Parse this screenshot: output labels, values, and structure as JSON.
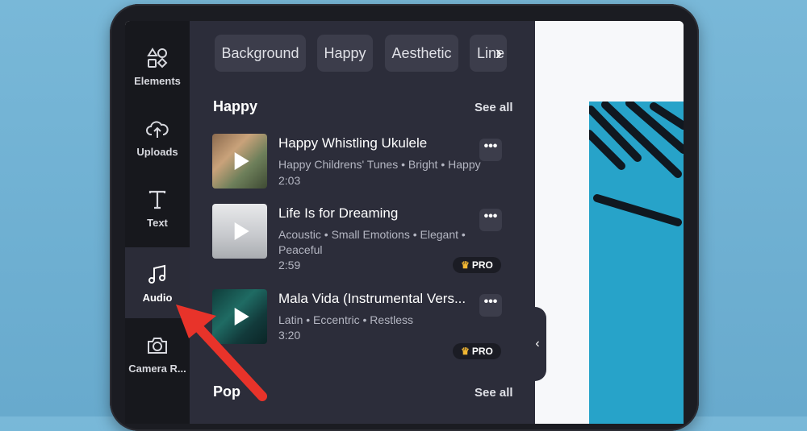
{
  "sidebar": {
    "items": [
      {
        "label": "Elements",
        "icon": "shapes-icon",
        "active": false
      },
      {
        "label": "Uploads",
        "icon": "cloud-upload-icon",
        "active": false
      },
      {
        "label": "Text",
        "icon": "text-icon",
        "active": false
      },
      {
        "label": "Audio",
        "icon": "music-note-icon",
        "active": true
      },
      {
        "label": "Camera R...",
        "icon": "camera-icon",
        "active": false
      }
    ]
  },
  "categories": [
    "Background",
    "Happy",
    "Aesthetic",
    "Line"
  ],
  "sections": [
    {
      "title": "Happy",
      "see_all": "See all",
      "tracks": [
        {
          "title": "Happy Whistling Ukulele",
          "tags": "Happy Childrens' Tunes • Bright • Happy",
          "duration": "2:03",
          "pro": false
        },
        {
          "title": "Life Is for Dreaming",
          "tags": "Acoustic • Small Emotions • Elegant • Peaceful",
          "duration": "2:59",
          "pro": true
        },
        {
          "title": "Mala Vida (Instrumental Vers...",
          "tags": "Latin • Eccentric • Restless",
          "duration": "3:20",
          "pro": true
        }
      ]
    },
    {
      "title": "Pop",
      "see_all": "See all"
    }
  ],
  "labels": {
    "more": "•••",
    "pro": "PRO",
    "collapse": "‹",
    "scroll_right": "›"
  },
  "colors": {
    "accent_pro_crown": "#f2b733",
    "artboard": "#27a3c9",
    "arrow": "#e8332a"
  }
}
